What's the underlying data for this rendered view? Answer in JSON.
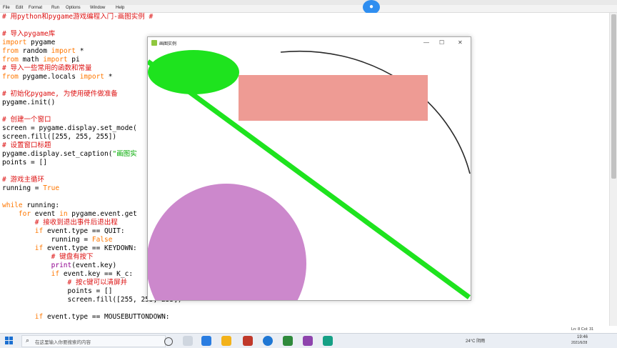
{
  "editor": {
    "menu": [
      "File",
      "Edit",
      "Format",
      "Run",
      "Options",
      "Window",
      "Help"
    ],
    "lines": [
      [
        {
          "t": "# 用python和pygame游戏编程入门-画图实例 #",
          "c": "cm"
        }
      ],
      [
        {
          "t": "",
          "c": ""
        }
      ],
      [
        {
          "t": "# 导入pygame库",
          "c": "cm"
        }
      ],
      [
        {
          "t": "import",
          "c": "kw"
        },
        {
          "t": " pygame",
          "c": ""
        }
      ],
      [
        {
          "t": "from",
          "c": "kw"
        },
        {
          "t": " random ",
          "c": ""
        },
        {
          "t": "import",
          "c": "kw"
        },
        {
          "t": " *",
          "c": ""
        }
      ],
      [
        {
          "t": "from",
          "c": "kw"
        },
        {
          "t": " math ",
          "c": ""
        },
        {
          "t": "import",
          "c": "kw"
        },
        {
          "t": " pi",
          "c": ""
        }
      ],
      [
        {
          "t": "# 导入一些常用的函数和常量",
          "c": "cm"
        }
      ],
      [
        {
          "t": "from",
          "c": "kw"
        },
        {
          "t": " pygame.locals ",
          "c": ""
        },
        {
          "t": "import",
          "c": "kw"
        },
        {
          "t": " *",
          "c": ""
        }
      ],
      [
        {
          "t": "",
          "c": ""
        }
      ],
      [
        {
          "t": "# 初始化pygame, 为使用硬件做准备",
          "c": "cm"
        }
      ],
      [
        {
          "t": "pygame.init()",
          "c": ""
        }
      ],
      [
        {
          "t": "",
          "c": ""
        }
      ],
      [
        {
          "t": "# 创建一个窗口",
          "c": "cm"
        }
      ],
      [
        {
          "t": "screen = pygame.display.set_mode(",
          "c": ""
        }
      ],
      [
        {
          "t": "screen.fill([255, 255, 255])",
          "c": ""
        }
      ],
      [
        {
          "t": "# 设置窗口标题",
          "c": "cm"
        }
      ],
      [
        {
          "t": "pygame.display.set_caption(",
          "c": ""
        },
        {
          "t": "\"画图实",
          "c": "st"
        }
      ],
      [
        {
          "t": "points = []",
          "c": ""
        }
      ],
      [
        {
          "t": "",
          "c": ""
        }
      ],
      [
        {
          "t": "# 游戏主循环",
          "c": "cm"
        }
      ],
      [
        {
          "t": "running = ",
          "c": ""
        },
        {
          "t": "True",
          "c": "kw"
        }
      ],
      [
        {
          "t": "",
          "c": ""
        }
      ],
      [
        {
          "t": "while",
          "c": "kw"
        },
        {
          "t": " running:",
          "c": ""
        }
      ],
      [
        {
          "t": "    ",
          "c": ""
        },
        {
          "t": "for",
          "c": "kw"
        },
        {
          "t": " event ",
          "c": ""
        },
        {
          "t": "in",
          "c": "kw"
        },
        {
          "t": " pygame.event.get",
          "c": ""
        }
      ],
      [
        {
          "t": "        ",
          "c": ""
        },
        {
          "t": "# 接收到退出事件后退出程",
          "c": "cm"
        }
      ],
      [
        {
          "t": "        ",
          "c": ""
        },
        {
          "t": "if",
          "c": "kw"
        },
        {
          "t": " event.type == QUIT:",
          "c": ""
        }
      ],
      [
        {
          "t": "            running = ",
          "c": ""
        },
        {
          "t": "False",
          "c": "kw"
        }
      ],
      [
        {
          "t": "        ",
          "c": ""
        },
        {
          "t": "if",
          "c": "kw"
        },
        {
          "t": " event.type == KEYDOWN:",
          "c": ""
        }
      ],
      [
        {
          "t": "            ",
          "c": ""
        },
        {
          "t": "# 键盘有按下",
          "c": "cm"
        }
      ],
      [
        {
          "t": "            ",
          "c": ""
        },
        {
          "t": "print",
          "c": "bi"
        },
        {
          "t": "(event.key)",
          "c": ""
        }
      ],
      [
        {
          "t": "            ",
          "c": ""
        },
        {
          "t": "if",
          "c": "kw"
        },
        {
          "t": " event.key == K_c:",
          "c": ""
        }
      ],
      [
        {
          "t": "                ",
          "c": ""
        },
        {
          "t": "# 按c键可以清屏并",
          "c": "cm"
        }
      ],
      [
        {
          "t": "                points = []",
          "c": ""
        }
      ],
      [
        {
          "t": "                screen.fill([255, 255, 255])",
          "c": ""
        }
      ],
      [
        {
          "t": "",
          "c": ""
        }
      ],
      [
        {
          "t": "        ",
          "c": ""
        },
        {
          "t": "if",
          "c": "kw"
        },
        {
          "t": " event.type == MOUSEBUTTONDOWN:",
          "c": ""
        }
      ]
    ],
    "status": "Ln: 8   Col: 31"
  },
  "pygame_window": {
    "title": "画图实例",
    "controls": [
      "—",
      "☐",
      "✕"
    ]
  },
  "taskbar": {
    "search_placeholder": "在这里输入你要搜索的内容",
    "weather": "24°C 阴雨",
    "time": "19:46",
    "date": "2021/6/28",
    "app_colors": [
      "#2a7de1",
      "#6b6b6b",
      "#f3b21b",
      "#c0392b",
      "#1f77d4",
      "#2f8a3c",
      "#e74c3c",
      "#8e44ad",
      "#16a085"
    ]
  },
  "overlay_button": {
    "label": "●"
  }
}
